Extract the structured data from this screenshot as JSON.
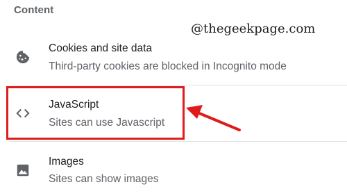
{
  "section": {
    "title": "Content"
  },
  "watermark": {
    "text": "@thegeekpage.com"
  },
  "rows": [
    {
      "icon": "cookie-icon",
      "title": "Cookies and site data",
      "subtitle": "Third-party cookies are blocked in Incognito mode"
    },
    {
      "icon": "code-brackets-icon",
      "title": "JavaScript",
      "subtitle": "Sites can use Javascript"
    },
    {
      "icon": "image-icon",
      "title": "Images",
      "subtitle": "Sites can show images"
    }
  ],
  "colors": {
    "highlight": "#e01b1b",
    "title_text": "#202124",
    "secondary_text": "#5f6368",
    "icon": "#5f6368"
  }
}
